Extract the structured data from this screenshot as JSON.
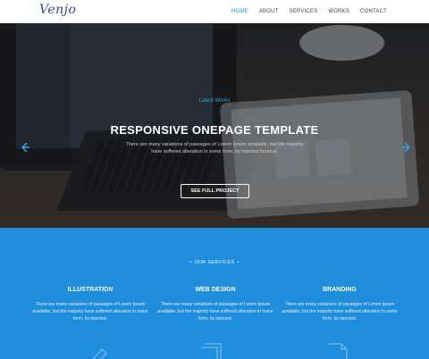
{
  "nav": {
    "logo": "Venjo",
    "items": [
      {
        "label": "HOME",
        "active": true
      },
      {
        "label": "ABOUT",
        "active": false
      },
      {
        "label": "SERVICES",
        "active": false
      },
      {
        "label": "WORKS",
        "active": false
      },
      {
        "label": "CONTACT",
        "active": false
      }
    ]
  },
  "hero": {
    "subtitle": "Latest Works",
    "title": "RESPONSIVE ONEPAGE TEMPLATE",
    "text": "There are many variations of passages of Lorem Ipsum available, but the majority have suffered alteration in some form, by injected humour.",
    "button": "SEE FULL PROJECT",
    "prev_icon": "arrow-left-icon",
    "next_icon": "arrow-right-icon"
  },
  "services": {
    "heading": "OUR SERVICES",
    "items": [
      {
        "title": "ILLUSTRATION",
        "text": "There are many variations of passages of Lorem Ipsum available, but the majority have suffered alteration in some form, by injected.",
        "icon": "pencil-icon"
      },
      {
        "title": "WEB DESIGN",
        "text": "There are many variations of passages of Lorem Ipsum available, but the majority have suffered alteration in some form, by injected.",
        "icon": "layers-icon"
      },
      {
        "title": "BRANDING",
        "text": "There are many variations of passages of Lorem Ipsum available, but the majority have suffered alteration in some form, by injected.",
        "icon": "document-icon"
      }
    ]
  },
  "colors": {
    "accent": "#1e8fe0",
    "services_bg": "#1e8ddc",
    "logo": "#2e4a87"
  }
}
